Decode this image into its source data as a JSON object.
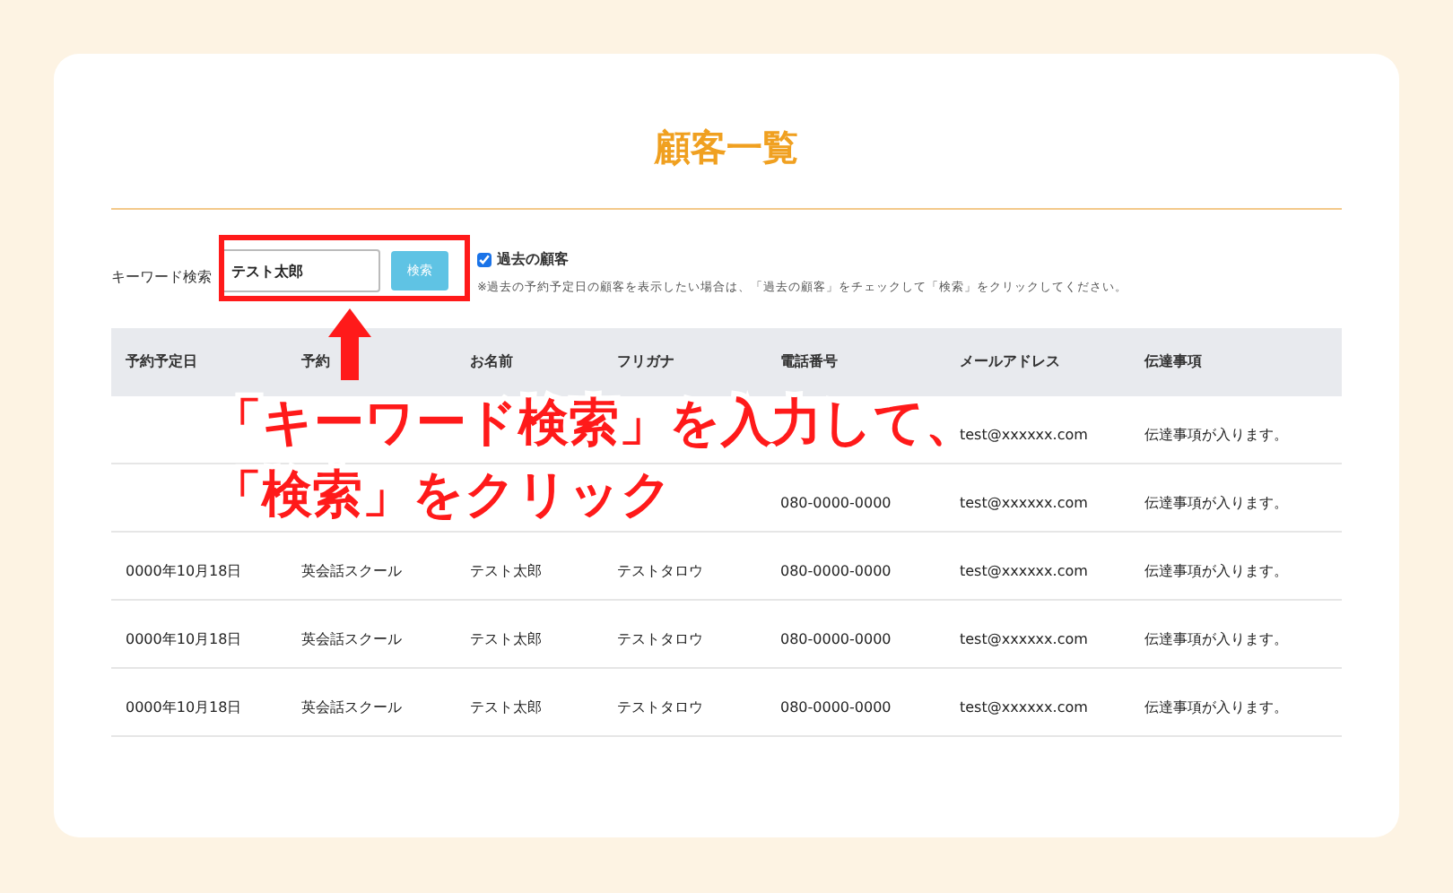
{
  "title": "顧客一覧",
  "search": {
    "label": "キーワード検索",
    "value": "テスト太郎",
    "button": "検索",
    "past_checkbox": {
      "label": "過去の顧客",
      "checked": true
    },
    "note": "※過去の予約予定日の顧客を表示したい場合は、「過去の顧客」をチェックして「検索」をクリックしてください。"
  },
  "table": {
    "columns": [
      "予約予定日",
      "予約",
      "お名前",
      "フリガナ",
      "電話番号",
      "メールアドレス",
      "伝達事項"
    ],
    "rows": [
      {
        "email": "test@xxxxxx.com",
        "notes": "伝達事項が入ります。"
      },
      {
        "phone": "080-0000-0000",
        "email": "test@xxxxxx.com",
        "notes": "伝達事項が入ります。"
      },
      {
        "date": "0000年10月18日",
        "course": "英会話スクール",
        "name": "テスト太郎",
        "kana": "テストタロウ",
        "phone": "080-0000-0000",
        "email": "test@xxxxxx.com",
        "notes": "伝達事項が入ります。"
      },
      {
        "date": "0000年10月18日",
        "course": "英会話スクール",
        "name": "テスト太郎",
        "kana": "テストタロウ",
        "phone": "080-0000-0000",
        "email": "test@xxxxxx.com",
        "notes": "伝達事項が入ります。"
      },
      {
        "date": "0000年10月18日",
        "course": "英会話スクール",
        "name": "テスト太郎",
        "kana": "テストタロウ",
        "phone": "080-0000-0000",
        "email": "test@xxxxxx.com",
        "notes": "伝達事項が入ります。"
      }
    ]
  },
  "annotation": {
    "lines": [
      "「キーワード検索」を入力して、",
      "「検索」をクリック"
    ]
  }
}
